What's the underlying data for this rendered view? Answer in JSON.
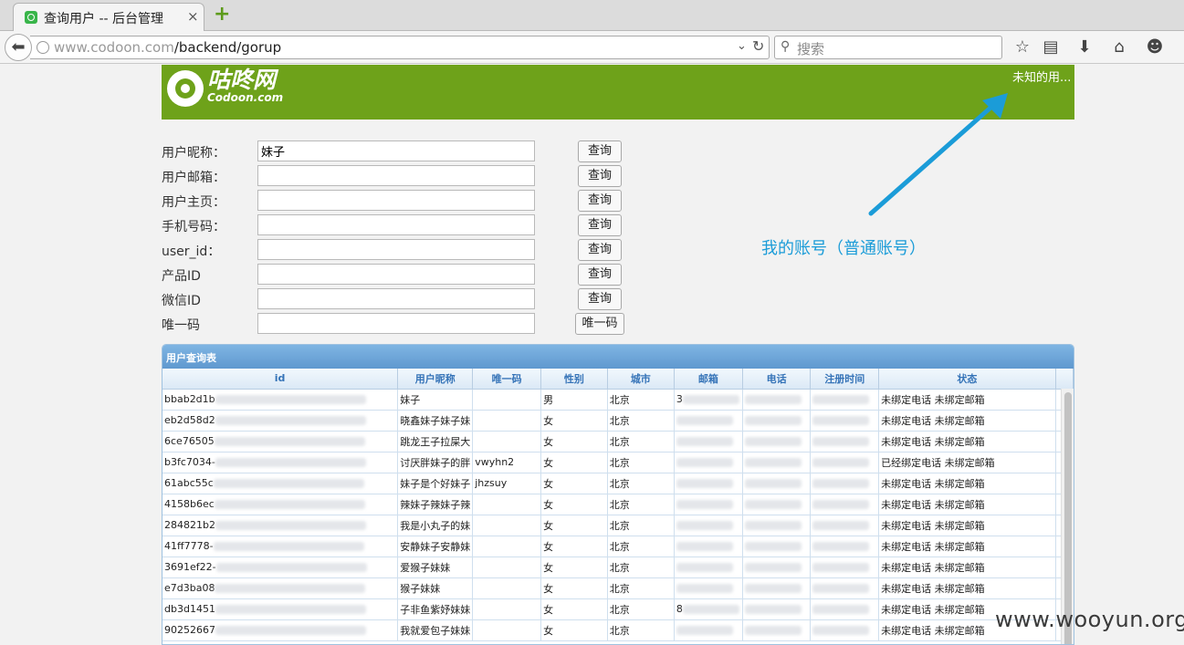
{
  "browser": {
    "tab_title": "查询用户 -- 后台管理",
    "tab_close": "×",
    "new_tab": "+",
    "url_host": "www.codoon.com",
    "url_path": "/backend/gorup",
    "search_placeholder": "搜索"
  },
  "header": {
    "logo_text": "咕咚网",
    "logo_sub": "Codoon.com",
    "user_link": "未知的用..."
  },
  "form": {
    "rows": [
      {
        "label": "用户昵称：",
        "value": "妹子",
        "button": "查询"
      },
      {
        "label": "用户邮箱：",
        "value": "",
        "button": "查询"
      },
      {
        "label": "用户主页：",
        "value": "",
        "button": "查询"
      },
      {
        "label": "手机号码：",
        "value": "",
        "button": "查询"
      },
      {
        "label": "user_id：",
        "value": "",
        "button": "查询"
      },
      {
        "label": "产品ID",
        "value": "",
        "button": "查询"
      },
      {
        "label": "微信ID",
        "value": "",
        "button": "查询"
      },
      {
        "label": "唯一码",
        "value": "",
        "button": "唯一码"
      }
    ]
  },
  "annotation": {
    "text": "我的账号（普通账号）",
    "color": "#1b9cd8"
  },
  "table": {
    "title": "用户查询表",
    "columns": [
      "id",
      "用户昵称",
      "唯一码",
      "性别",
      "城市",
      "邮箱",
      "电话",
      "注册时间",
      "状态"
    ],
    "rows": [
      {
        "id": "bbab2d1b",
        "nick": "妹子",
        "code": "",
        "gender": "男",
        "city": "北京",
        "email": "3",
        "status": "未绑定电话 未绑定邮箱"
      },
      {
        "id": "eb2d58d2",
        "nick": "晓鑫妹子妹子妹",
        "code": "",
        "gender": "女",
        "city": "北京",
        "email": "",
        "status": "未绑定电话 未绑定邮箱"
      },
      {
        "id": "6ce76505",
        "nick": "跳龙王子拉屎大",
        "code": "",
        "gender": "女",
        "city": "北京",
        "email": "",
        "status": "未绑定电话 未绑定邮箱"
      },
      {
        "id": "b3fc7034-",
        "nick": "讨厌胖妹子的胖",
        "code": "vwyhn2",
        "gender": "女",
        "city": "北京",
        "email": "",
        "status": "已经绑定电话 未绑定邮箱"
      },
      {
        "id": "61abc55c",
        "nick": "妹子是个好妹子",
        "code": "jhzsuy",
        "gender": "女",
        "city": "北京",
        "email": "",
        "status": "未绑定电话 未绑定邮箱"
      },
      {
        "id": "4158b6ec",
        "nick": "辣妹子辣妹子辣",
        "code": "",
        "gender": "女",
        "city": "北京",
        "email": "",
        "status": "未绑定电话 未绑定邮箱"
      },
      {
        "id": "284821b2",
        "nick": "我是小丸子的妹",
        "code": "",
        "gender": "女",
        "city": "北京",
        "email": "",
        "status": "未绑定电话 未绑定邮箱"
      },
      {
        "id": "41ff7778-",
        "nick": "安静妹子安静妹",
        "code": "",
        "gender": "女",
        "city": "北京",
        "email": "",
        "status": "未绑定电话 未绑定邮箱"
      },
      {
        "id": "3691ef22-",
        "nick": "爱猴子妹妹",
        "code": "",
        "gender": "女",
        "city": "北京",
        "email": "",
        "status": "未绑定电话 未绑定邮箱"
      },
      {
        "id": "e7d3ba08",
        "nick": "猴子妹妹",
        "code": "",
        "gender": "女",
        "city": "北京",
        "email": "",
        "status": "未绑定电话 未绑定邮箱"
      },
      {
        "id": "db3d1451",
        "nick": "子非鱼紫妤妹妹",
        "code": "",
        "gender": "女",
        "city": "北京",
        "email": "8",
        "status": "未绑定电话 未绑定邮箱"
      },
      {
        "id": "90252667",
        "nick": "我就爱包子妹妹",
        "code": "",
        "gender": "女",
        "city": "北京",
        "email": "",
        "status": "未绑定电话 未绑定邮箱"
      }
    ]
  },
  "watermark": "www.wooyun.org",
  "colors": {
    "header_green": "#6ea21a",
    "table_blue": "#5f98cf",
    "annotation_blue": "#1b9cd8"
  }
}
